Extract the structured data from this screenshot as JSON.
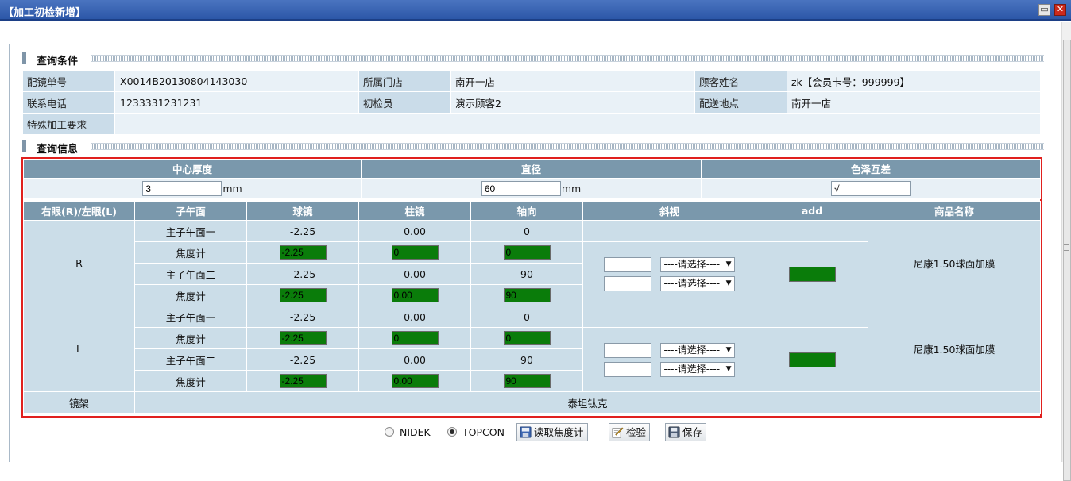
{
  "window": {
    "title": "【加工初检新增】",
    "minimize_icon": "minimize-icon",
    "close_icon": "close-icon"
  },
  "query_section": {
    "title": "查询条件",
    "rows": [
      [
        {
          "label": "配镜单号",
          "value": "X0014B20130804143030"
        },
        {
          "label": "所属门店",
          "value": "南开一店"
        },
        {
          "label": "顾客姓名",
          "value": "zk【会员卡号：999999】"
        }
      ],
      [
        {
          "label": "联系电话",
          "value": "1233331231231"
        },
        {
          "label": "初检员",
          "value": "演示顾客2"
        },
        {
          "label": "配送地点",
          "value": "南开一店"
        }
      ]
    ],
    "special": {
      "label": "特殊加工要求",
      "value": ""
    }
  },
  "info_section": {
    "title": "查询信息",
    "top_headers": [
      "中心厚度",
      "直径",
      "色泽互差"
    ],
    "center_thickness": {
      "value": "3",
      "unit": "mm"
    },
    "diameter": {
      "value": "60",
      "unit": "mm"
    },
    "color_diff": {
      "value": "√"
    },
    "headers": [
      "右眼(R)/左眼(L)",
      "子午面",
      "球镜",
      "柱镜",
      "轴向",
      "斜视",
      "add",
      "商品名称"
    ],
    "eyes": [
      {
        "eye": "R",
        "rows": [
          {
            "meridian": "主子午面一",
            "sphere": "-2.25",
            "cylinder": "0.00",
            "axis": "0"
          },
          {
            "meridian": "焦度计",
            "sphere": "-2.25",
            "cylinder": "0",
            "axis": "0"
          },
          {
            "meridian": "主子午面二",
            "sphere": "-2.25",
            "cylinder": "0.00",
            "axis": "90"
          },
          {
            "meridian": "焦度计",
            "sphere": "-2.25",
            "cylinder": "0.00",
            "axis": "90"
          }
        ],
        "prism_select_1": "----请选择----",
        "prism_select_2": "----请选择----",
        "product": "尼康1.50球面加膜"
      },
      {
        "eye": "L",
        "rows": [
          {
            "meridian": "主子午面一",
            "sphere": "-2.25",
            "cylinder": "0.00",
            "axis": "0"
          },
          {
            "meridian": "焦度计",
            "sphere": "-2.25",
            "cylinder": "0",
            "axis": "0"
          },
          {
            "meridian": "主子午面二",
            "sphere": "-2.25",
            "cylinder": "0.00",
            "axis": "90"
          },
          {
            "meridian": "焦度计",
            "sphere": "-2.25",
            "cylinder": "0.00",
            "axis": "90"
          }
        ],
        "prism_select_1": "----请选择----",
        "prism_select_2": "----请选择----",
        "product": "尼康1.50球面加膜"
      }
    ],
    "frame": {
      "label": "镜架",
      "value": "泰坦钛克"
    }
  },
  "toolbar": {
    "radio_nidek": "NIDEK",
    "radio_topcon": "TOPCON",
    "selected_device": "TOPCON",
    "read_button": "读取焦度计",
    "check_button": "检验",
    "save_button": "保存"
  },
  "colors": {
    "title_bar": "#2c57a8",
    "header_bg": "#7a98ac",
    "cell_bg": "#cbdde8",
    "label_bg": "#cadce9",
    "highlight_border": "#e0201e",
    "lensmeter_fill": "#0a7c0a"
  }
}
